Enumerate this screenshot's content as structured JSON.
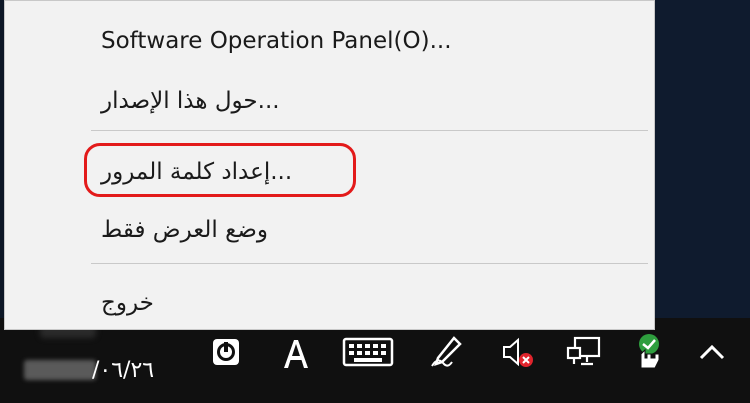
{
  "menu": {
    "items": [
      {
        "label": "Software Operation Panel(O)..."
      },
      {
        "label": "...حول هذا الإصدار"
      },
      {
        "label": "...إعداد كلمة المرور"
      },
      {
        "label": "وضع العرض فقط"
      },
      {
        "label": "خروج"
      }
    ],
    "highlight_color": "#e31a1a"
  },
  "taskbar": {
    "date": "/٠٦/٢٦",
    "tray_icons": [
      "onenote-icon",
      "ime-language-icon",
      "touch-keyboard-icon",
      "pen-icon",
      "speaker-muted-icon",
      "network-icon",
      "scanner-app-icon",
      "chevron-up-icon"
    ]
  }
}
